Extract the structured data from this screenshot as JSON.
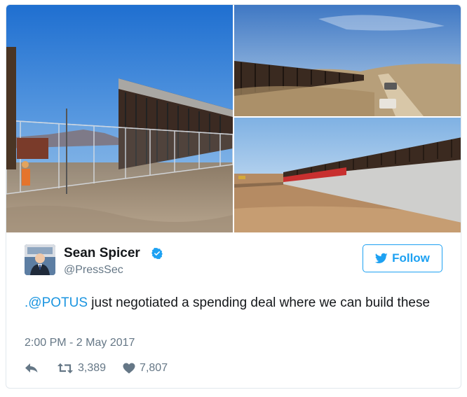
{
  "tweet": {
    "author_name": "Sean Spicer",
    "author_handle": "@PressSec",
    "follow_label": "Follow",
    "text_mention": ".@POTUS",
    "text_body": " just negotiated a spending deal where we can build these",
    "timestamp": "2:00 PM - 2 May 2017",
    "retweet_count": "3,389",
    "like_count": "7,807"
  },
  "media": {
    "photos": [
      {
        "name": "border-wall-photo-1"
      },
      {
        "name": "border-wall-photo-2"
      },
      {
        "name": "border-wall-photo-3"
      }
    ]
  },
  "icons": {
    "verified": "verified-badge-icon",
    "follow": "twitter-bird-icon",
    "reply": "reply-icon",
    "retweet": "retweet-icon",
    "like": "heart-icon"
  },
  "colors": {
    "accent": "#1da1f2",
    "mention": "#1b95e0",
    "muted": "#657786",
    "text": "#14171a"
  }
}
